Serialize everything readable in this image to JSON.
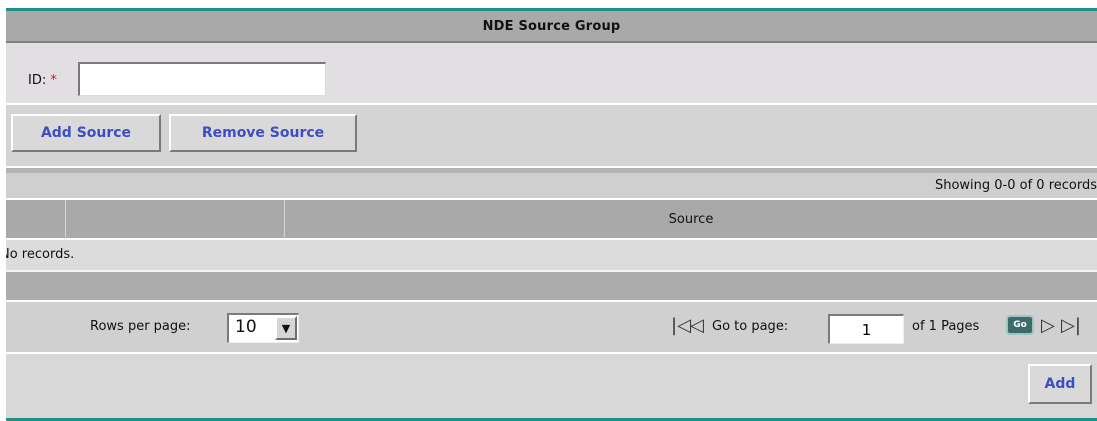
{
  "form": {
    "title": "NDE Source Group",
    "id_label": "ID:",
    "required_marker": "*",
    "id_value": ""
  },
  "toolbar": {
    "add_source_label": "Add Source",
    "remove_source_label": "Remove Source"
  },
  "table": {
    "showing_text": "Showing 0-0 of 0 records",
    "columns": [
      "",
      "",
      "Source"
    ],
    "empty_text": "No records."
  },
  "pager": {
    "rows_per_page_label": "Rows per page:",
    "rows_per_page_value": "10",
    "goto_label": "Go to page:",
    "page_value": "1",
    "of_pages_text": "of 1 Pages",
    "go_label": "Go"
  },
  "actions": {
    "add_label": "Add"
  },
  "icons": {
    "first": "first-page-icon",
    "prev": "previous-page-icon",
    "next": "next-page-icon",
    "last": "last-page-icon",
    "dropdown": "chevron-down-icon"
  },
  "colors": {
    "accent_line": "#1f8f8a",
    "button_text": "#3d4fc0",
    "required": "#e01010",
    "header_bg": "#a9a9a9"
  }
}
